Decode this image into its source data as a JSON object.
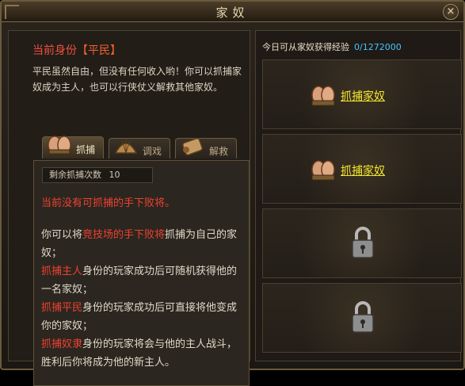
{
  "window": {
    "title": "家奴",
    "close_label": "×"
  },
  "identity": {
    "prefix": "当前身份",
    "value": "【平民】"
  },
  "description": "平民虽然自由，但没有任何收入哟！你可以抓捕家奴成为主人，也可以行侠仗义解救其他家奴。",
  "tabs": [
    {
      "label": "抓捕",
      "icon": "hands-icon",
      "active": true
    },
    {
      "label": "调戏",
      "icon": "fan-icon",
      "active": false
    },
    {
      "label": "解救",
      "icon": "scroll-icon",
      "active": false
    }
  ],
  "remaining": {
    "label": "剩余抓捕次数",
    "value": "10"
  },
  "no_captive_text": "当前没有可抓捕的手下败将。",
  "explain": {
    "intro_a": "你可以将",
    "intro_red": "竞技场的手下败将",
    "intro_b": "抓捕为自己的家奴；",
    "r1_red": "抓捕主人",
    "r1_text": "身份的玩家成功后可随机获得他的一名家奴；",
    "r2_red": "抓捕平民",
    "r2_text": "身份的玩家成功后可直接将他变成你的家奴；",
    "r3_red": "抓捕奴隶",
    "r3_text": "身份的玩家将会与他的主人战斗，胜利后你将成为他的新主人。"
  },
  "exp": {
    "label": "今日可从家奴获得经验",
    "value": "0/1272000"
  },
  "slots": [
    {
      "type": "capture",
      "label": "抓捕家奴"
    },
    {
      "type": "capture",
      "label": "抓捕家奴"
    },
    {
      "type": "locked"
    },
    {
      "type": "locked"
    }
  ],
  "colors": {
    "accent_red": "#ee4130",
    "link_yellow": "#f2e62d",
    "exp_blue": "#46c3ff"
  }
}
